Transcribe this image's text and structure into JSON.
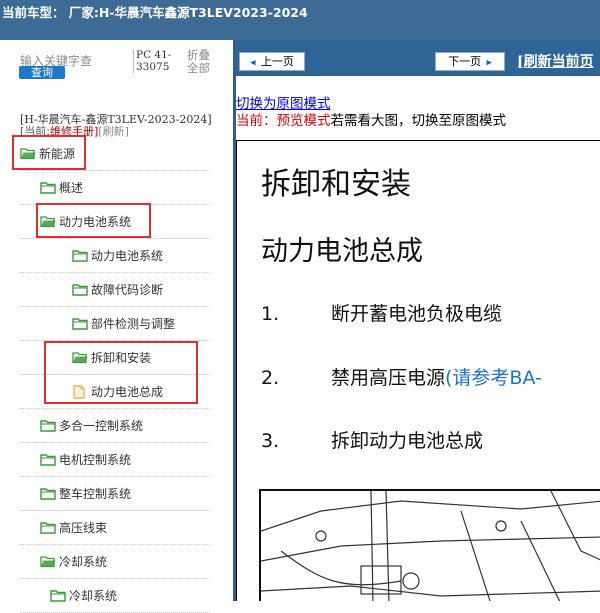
{
  "header": {
    "title": "当前车型：  厂家:H-华晨汽车鑫源T3LEV2023-2024"
  },
  "sidebar": {
    "search_placeholder": "输入关键字查",
    "query_label": "查询",
    "pc_code": "PC 41-33075",
    "collapse_all": "折叠全部",
    "vehicle": "[H-华晨汽车-鑫源T3LEV-2023-2024]",
    "current_prefix": "[当前:",
    "current_mode": "维修手册]",
    "refresh": "[刷新]",
    "tree": [
      {
        "label": "新能源",
        "icon": "folder-open-icon"
      },
      {
        "label": "概述",
        "icon": "folder-icon"
      },
      {
        "label": "动力电池系统",
        "icon": "folder-open-icon"
      },
      {
        "label": "动力电池系统",
        "icon": "folder-icon"
      },
      {
        "label": "故障代码诊断",
        "icon": "folder-icon"
      },
      {
        "label": "部件检测与调整",
        "icon": "folder-icon"
      },
      {
        "label": "拆卸和安装",
        "icon": "folder-open-icon"
      },
      {
        "label": "动力电池总成",
        "icon": "document-icon"
      },
      {
        "label": "多合一控制系统",
        "icon": "folder-icon"
      },
      {
        "label": "电机控制系统",
        "icon": "folder-icon"
      },
      {
        "label": "整车控制系统",
        "icon": "folder-icon"
      },
      {
        "label": "高压线束",
        "icon": "folder-icon"
      },
      {
        "label": "冷却系统",
        "icon": "folder-open-icon"
      },
      {
        "label": "冷却系统",
        "icon": "folder-icon"
      }
    ]
  },
  "toolbar": {
    "prev_label": "上一页",
    "next_label": "下一页",
    "refresh_label": "[刷新当前页"
  },
  "content": {
    "switch_link": "切换为原图模式",
    "mode_prefix": "当前：",
    "mode_name": "预览模式",
    "mode_suffix": "若需看大图，切换至原图模式",
    "doc_title": "拆卸和安装",
    "doc_subtitle": "动力电池总成",
    "steps": [
      {
        "num": "1.",
        "text": "断开蓄电池负极电缆",
        "ref": ""
      },
      {
        "num": "2.",
        "text": "禁用高压电源",
        "ref": "(请参考BA-"
      },
      {
        "num": "3.",
        "text": "拆卸动力电池总成",
        "ref": ""
      }
    ]
  },
  "colors": {
    "header_bg": "#3e6b95",
    "navbar_bg": "#2f6596",
    "highlight_box": "#e0302e",
    "folder_green": "#3a9a3a",
    "link_blue": "#0000ee"
  }
}
